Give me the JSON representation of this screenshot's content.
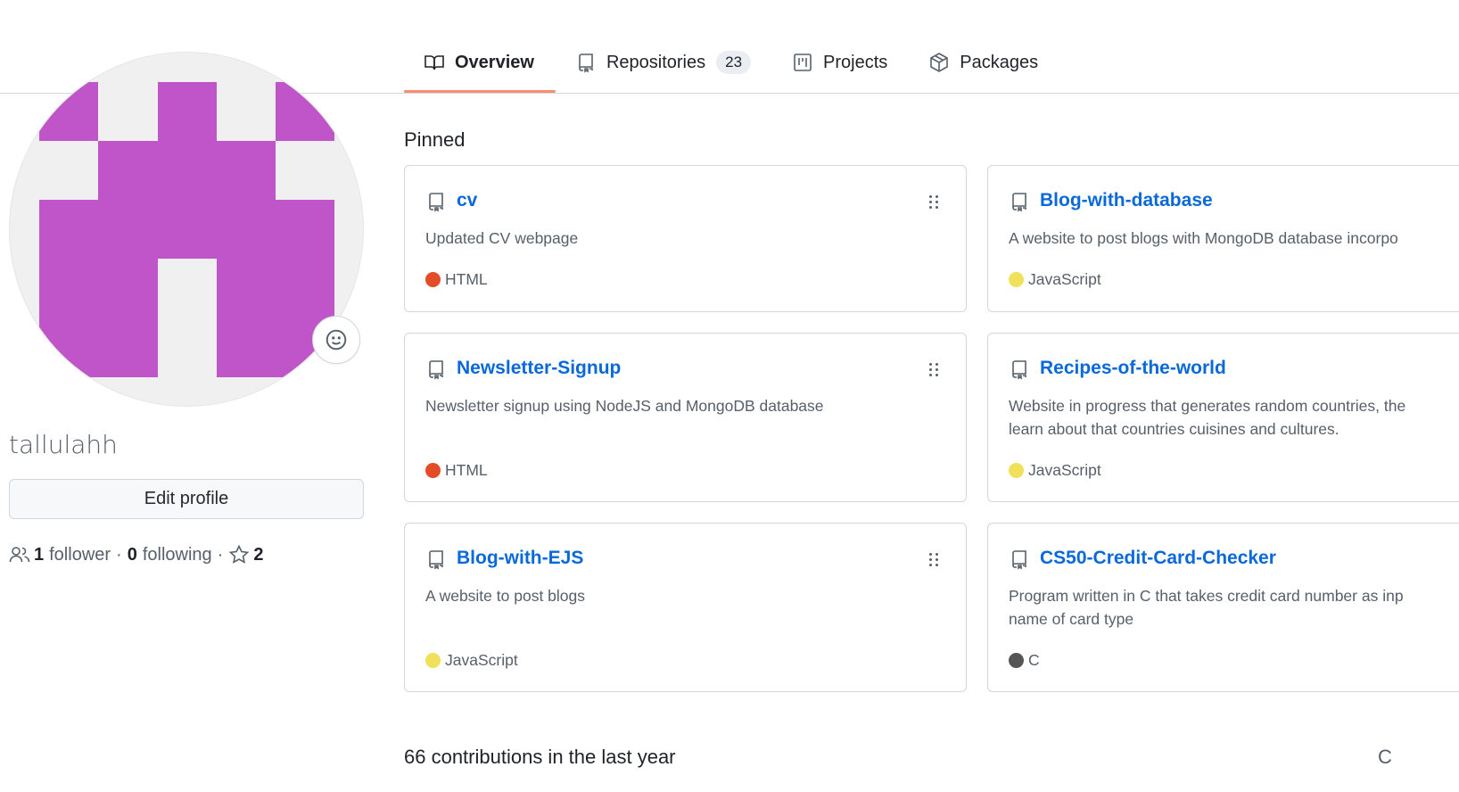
{
  "tabs": [
    {
      "label": "Overview",
      "icon": "book-icon",
      "selected": true
    },
    {
      "label": "Repositories",
      "icon": "repo-icon",
      "count": "23"
    },
    {
      "label": "Projects",
      "icon": "project-icon"
    },
    {
      "label": "Packages",
      "icon": "package-icon"
    }
  ],
  "profile": {
    "username": "tallulahh",
    "edit_label": "Edit profile",
    "followers_count": "1",
    "followers_label": "follower",
    "following_count": "0",
    "following_label": "following",
    "stars_count": "2",
    "separator": "·",
    "avatar_color": "#bf55c8",
    "avatar_bg": "#f0f0f0"
  },
  "pinned": {
    "title": "Pinned",
    "repos": [
      {
        "name": "cv",
        "description": "Updated CV webpage",
        "language": "HTML",
        "lang_color": "#e34c26"
      },
      {
        "name": "Blog-with-database",
        "description": "A website to post blogs with MongoDB database incorpo",
        "language": "JavaScript",
        "lang_color": "#f1e05a"
      },
      {
        "name": "Newsletter-Signup",
        "description": "Newsletter signup using NodeJS and MongoDB database",
        "language": "HTML",
        "lang_color": "#e34c26"
      },
      {
        "name": "Recipes-of-the-world",
        "description_lines": [
          "Website in progress that generates random countries, the",
          "learn about that countries cuisines and cultures."
        ],
        "language": "JavaScript",
        "lang_color": "#f1e05a"
      },
      {
        "name": "Blog-with-EJS",
        "description": "A website to post blogs",
        "language": "JavaScript",
        "lang_color": "#f1e05a"
      },
      {
        "name": "CS50-Credit-Card-Checker",
        "description_lines": [
          "Program written in C that takes credit card number as inp",
          "name of card type"
        ],
        "language": "C",
        "lang_color": "#555555"
      }
    ]
  },
  "contributions": {
    "text": "66 contributions in the last year",
    "right_text": "C"
  }
}
